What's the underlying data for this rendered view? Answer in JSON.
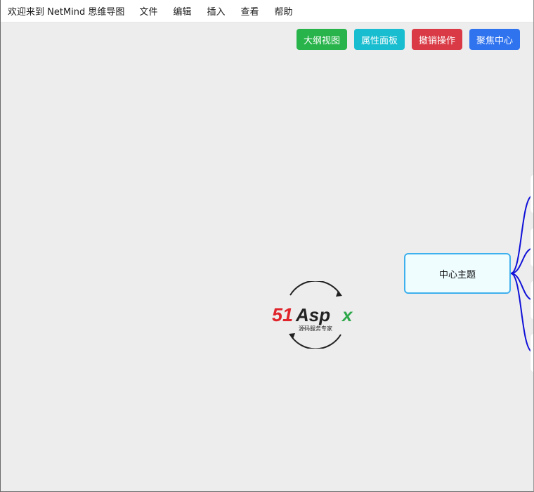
{
  "app": {
    "title": "欢迎来到 NetMind 思维导图"
  },
  "menu": [
    {
      "label": "文件"
    },
    {
      "label": "编辑"
    },
    {
      "label": "插入"
    },
    {
      "label": "查看"
    },
    {
      "label": "帮助"
    }
  ],
  "toolbar": {
    "buttons": [
      {
        "label": "大纲视图",
        "color": "#28b44a"
      },
      {
        "label": "属性面板",
        "color": "#18bdd0"
      },
      {
        "label": "撤销操作",
        "color": "#d93a45"
      },
      {
        "label": "聚焦中心",
        "color": "#2f73ef"
      }
    ]
  },
  "mindmap": {
    "center_topic": "中心主题",
    "center_border_color": "#3fb0ee",
    "link_color": "#1010d8",
    "children_count": 4
  },
  "watermark": {
    "brand": "51Aspx",
    "tagline": "源码服务专家"
  }
}
